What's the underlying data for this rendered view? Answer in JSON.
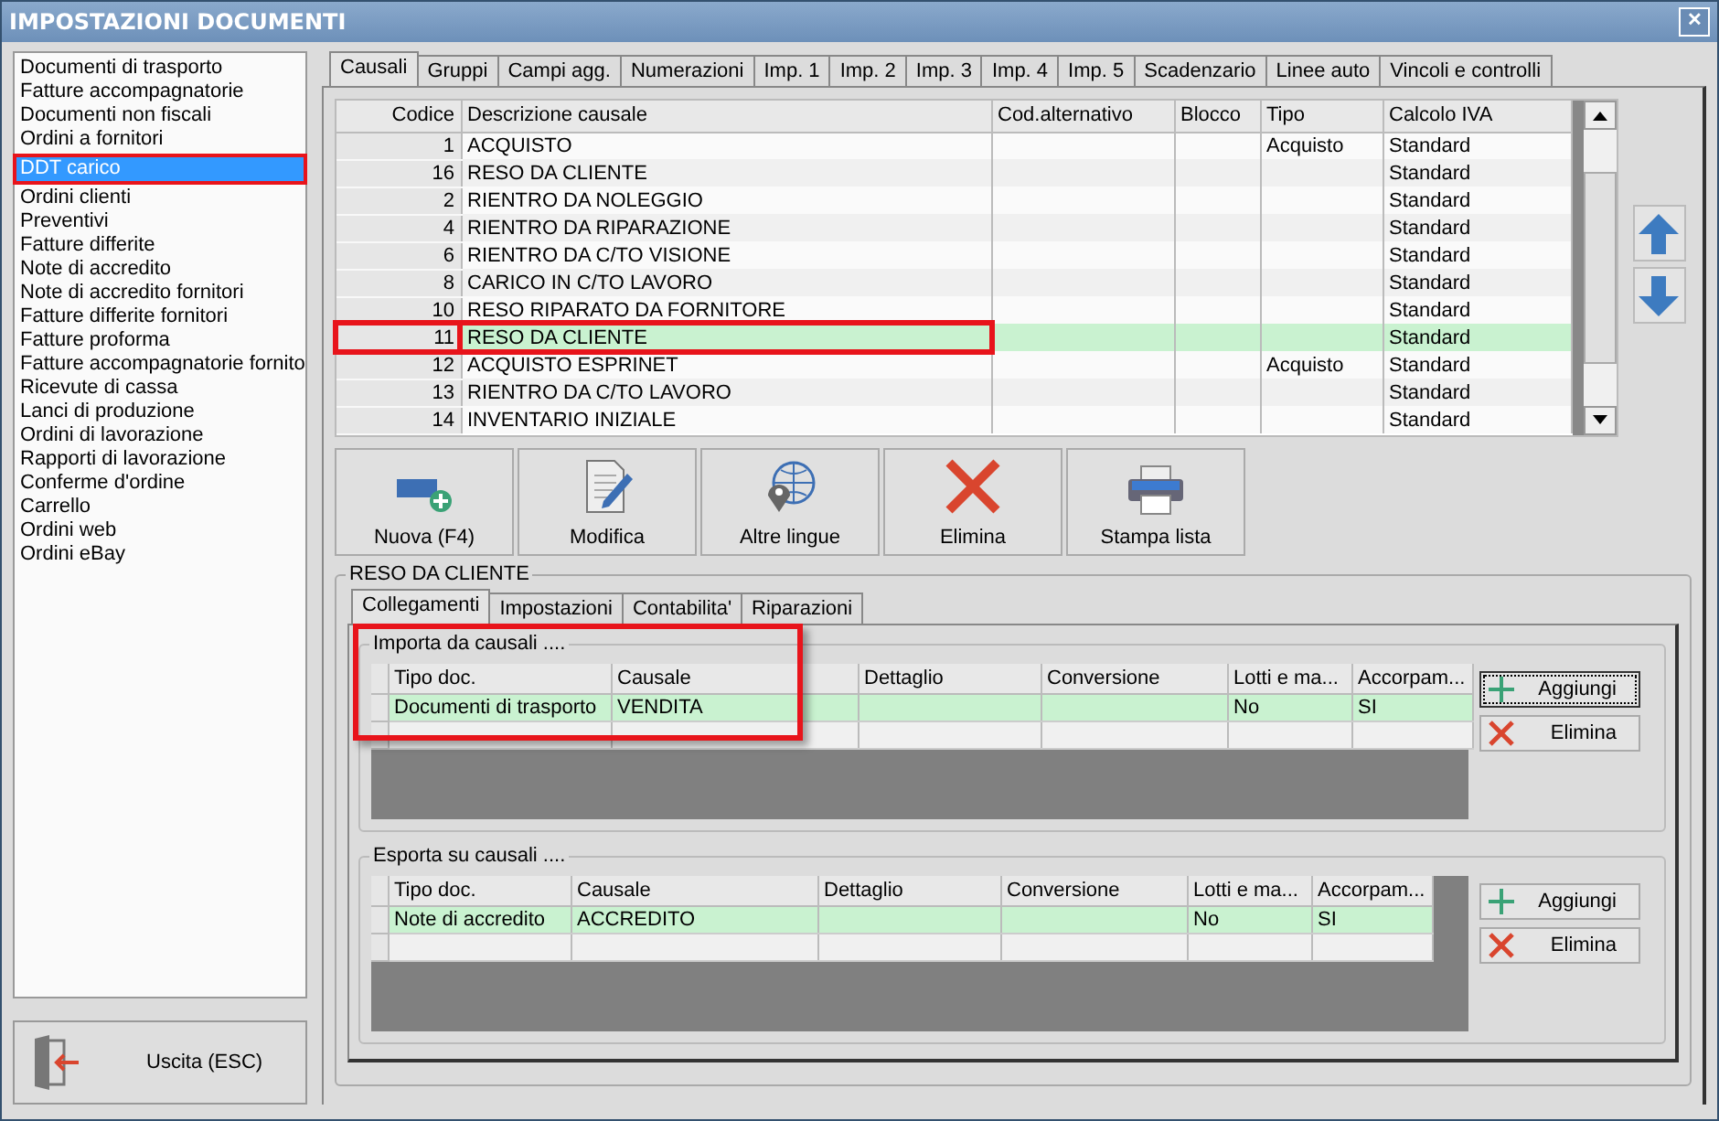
{
  "window": {
    "title": "IMPOSTAZIONI DOCUMENTI",
    "close": "✕"
  },
  "sidebar": {
    "items": [
      {
        "label": "Documenti di trasporto",
        "selected": false,
        "highlighted": false
      },
      {
        "label": "Fatture accompagnatorie",
        "selected": false,
        "highlighted": false
      },
      {
        "label": "Documenti non fiscali",
        "selected": false,
        "highlighted": false
      },
      {
        "label": "Ordini a fornitori",
        "selected": false,
        "highlighted": false
      },
      {
        "label": "DDT carico",
        "selected": true,
        "highlighted": true
      },
      {
        "label": "Ordini clienti",
        "selected": false,
        "highlighted": false
      },
      {
        "label": "Preventivi",
        "selected": false,
        "highlighted": false
      },
      {
        "label": "Fatture differite",
        "selected": false,
        "highlighted": false
      },
      {
        "label": "Note di accredito",
        "selected": false,
        "highlighted": false
      },
      {
        "label": "Note di accredito fornitori",
        "selected": false,
        "highlighted": false
      },
      {
        "label": "Fatture differite fornitori",
        "selected": false,
        "highlighted": false
      },
      {
        "label": "Fatture proforma",
        "selected": false,
        "highlighted": false
      },
      {
        "label": "Fatture accompagnatorie fornito",
        "selected": false,
        "highlighted": false
      },
      {
        "label": "Ricevute di cassa",
        "selected": false,
        "highlighted": false
      },
      {
        "label": "Lanci di produzione",
        "selected": false,
        "highlighted": false
      },
      {
        "label": "Ordini di lavorazione",
        "selected": false,
        "highlighted": false
      },
      {
        "label": "Rapporti di lavorazione",
        "selected": false,
        "highlighted": false
      },
      {
        "label": "Conferme d'ordine",
        "selected": false,
        "highlighted": false
      },
      {
        "label": "Carrello",
        "selected": false,
        "highlighted": false
      },
      {
        "label": "Ordini web",
        "selected": false,
        "highlighted": false
      },
      {
        "label": "Ordini eBay",
        "selected": false,
        "highlighted": false
      }
    ],
    "exit_button": "Uscita (ESC)"
  },
  "tabs": [
    {
      "label": "Causali",
      "selected": true
    },
    {
      "label": "Gruppi",
      "selected": false
    },
    {
      "label": "Campi agg.",
      "selected": false
    },
    {
      "label": "Numerazioni",
      "selected": false
    },
    {
      "label": "Imp. 1",
      "selected": false
    },
    {
      "label": "Imp. 2",
      "selected": false
    },
    {
      "label": "Imp. 3",
      "selected": false
    },
    {
      "label": "Imp. 4",
      "selected": false
    },
    {
      "label": "Imp. 5",
      "selected": false
    },
    {
      "label": "Scadenzario",
      "selected": false
    },
    {
      "label": "Linee auto",
      "selected": false
    },
    {
      "label": "Vincoli e controlli",
      "selected": false
    }
  ],
  "table": {
    "columns": [
      "Codice",
      "Descrizione causale",
      "Cod.alternativo",
      "Blocco",
      "Tipo",
      "Calcolo IVA"
    ],
    "rows": [
      {
        "cells": [
          "1",
          "ACQUISTO",
          "",
          "",
          "Acquisto",
          "Standard"
        ],
        "selected": false,
        "highlighted": false
      },
      {
        "cells": [
          "16",
          "RESO DA CLIENTE",
          "",
          "",
          "",
          "Standard"
        ],
        "selected": false,
        "highlighted": false
      },
      {
        "cells": [
          "2",
          "RIENTRO DA NOLEGGIO",
          "",
          "",
          "",
          "Standard"
        ],
        "selected": false,
        "highlighted": false
      },
      {
        "cells": [
          "4",
          "RIENTRO DA RIPARAZIONE",
          "",
          "",
          "",
          "Standard"
        ],
        "selected": false,
        "highlighted": false
      },
      {
        "cells": [
          "6",
          "RIENTRO DA C/TO VISIONE",
          "",
          "",
          "",
          "Standard"
        ],
        "selected": false,
        "highlighted": false
      },
      {
        "cells": [
          "8",
          "CARICO IN C/TO LAVORO",
          "",
          "",
          "",
          "Standard"
        ],
        "selected": false,
        "highlighted": false
      },
      {
        "cells": [
          "10",
          "RESO RIPARATO DA FORNITORE",
          "",
          "",
          "",
          "Standard"
        ],
        "selected": false,
        "highlighted": false
      },
      {
        "cells": [
          "11",
          "RESO DA CLIENTE",
          "",
          "",
          "",
          "Standard"
        ],
        "selected": true,
        "highlighted": true
      },
      {
        "cells": [
          "12",
          "ACQUISTO ESPRINET",
          "",
          "",
          "Acquisto",
          "Standard"
        ],
        "selected": false,
        "highlighted": false
      },
      {
        "cells": [
          "13",
          "RIENTRO DA C/TO LAVORO",
          "",
          "",
          "",
          "Standard"
        ],
        "selected": false,
        "highlighted": false
      },
      {
        "cells": [
          "14",
          "INVENTARIO INIZIALE",
          "",
          "",
          "",
          "Standard"
        ],
        "selected": false,
        "highlighted": false
      }
    ]
  },
  "toolbar": [
    {
      "kind": "new",
      "label": "Nuova (F4)"
    },
    {
      "kind": "edit",
      "label": "Modifica"
    },
    {
      "kind": "languages",
      "label": "Altre lingue"
    },
    {
      "kind": "delete",
      "label": "Elimina"
    },
    {
      "kind": "print",
      "label": "Stampa lista"
    }
  ],
  "detail": {
    "title": "RESO DA CLIENTE",
    "tabs": [
      {
        "label": "Collegamenti",
        "selected": true
      },
      {
        "label": "Impostazioni",
        "selected": false
      },
      {
        "label": "Contabilita'",
        "selected": false
      },
      {
        "label": "Riparazioni",
        "selected": false
      }
    ],
    "groups": [
      {
        "title": "Importa da causali ....",
        "highlighted": true,
        "columns": [
          "Tipo doc.",
          "Causale",
          "Dettaglio",
          "Conversione",
          "Lotti e ma...",
          "Accorpam..."
        ],
        "rows": [
          {
            "cells": [
              "Documenti di trasporto",
              "VENDITA",
              "",
              "",
              "No",
              "SI"
            ],
            "selected": true
          },
          {
            "cells": [
              "",
              "",
              "",
              "",
              "",
              ""
            ],
            "selected": false
          }
        ],
        "buttons": [
          {
            "kind": "add",
            "label": "Aggiungi",
            "focused": true
          },
          {
            "kind": "delete",
            "label": "Elimina",
            "focused": false
          }
        ]
      },
      {
        "title": "Esporta su causali ....",
        "highlighted": false,
        "columns": [
          "Tipo doc.",
          "Causale",
          "Dettaglio",
          "Conversione",
          "Lotti e ma...",
          "Accorpam..."
        ],
        "rows": [
          {
            "cells": [
              "Note di accredito",
              "ACCREDITO",
              "",
              "",
              "No",
              "SI"
            ],
            "selected": true
          },
          {
            "cells": [
              "",
              "",
              "",
              "",
              "",
              ""
            ],
            "selected": false
          }
        ],
        "buttons": [
          {
            "kind": "add",
            "label": "Aggiungi",
            "focused": false
          },
          {
            "kind": "delete",
            "label": "Elimina",
            "focused": false
          }
        ]
      }
    ]
  }
}
